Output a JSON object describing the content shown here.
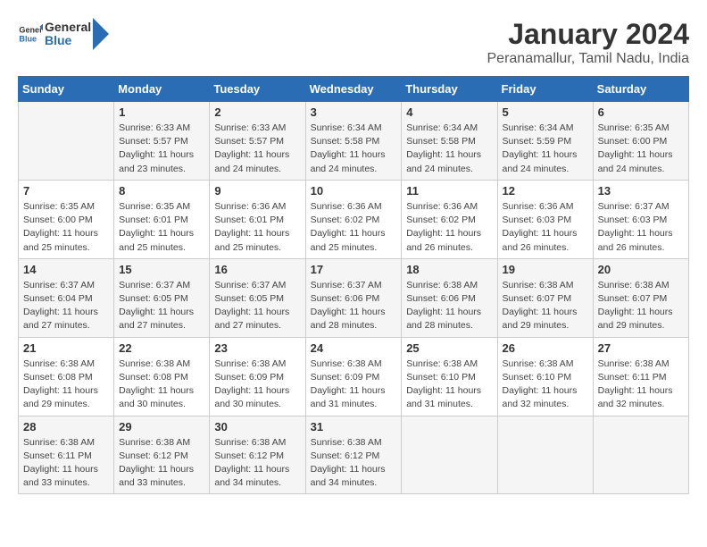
{
  "header": {
    "logo_line1": "General",
    "logo_line2": "Blue",
    "month": "January 2024",
    "location": "Peranamallur, Tamil Nadu, India"
  },
  "weekdays": [
    "Sunday",
    "Monday",
    "Tuesday",
    "Wednesday",
    "Thursday",
    "Friday",
    "Saturday"
  ],
  "weeks": [
    [
      {
        "day": "",
        "sunrise": "",
        "sunset": "",
        "daylight": ""
      },
      {
        "day": "1",
        "sunrise": "Sunrise: 6:33 AM",
        "sunset": "Sunset: 5:57 PM",
        "daylight": "Daylight: 11 hours and 23 minutes."
      },
      {
        "day": "2",
        "sunrise": "Sunrise: 6:33 AM",
        "sunset": "Sunset: 5:57 PM",
        "daylight": "Daylight: 11 hours and 24 minutes."
      },
      {
        "day": "3",
        "sunrise": "Sunrise: 6:34 AM",
        "sunset": "Sunset: 5:58 PM",
        "daylight": "Daylight: 11 hours and 24 minutes."
      },
      {
        "day": "4",
        "sunrise": "Sunrise: 6:34 AM",
        "sunset": "Sunset: 5:58 PM",
        "daylight": "Daylight: 11 hours and 24 minutes."
      },
      {
        "day": "5",
        "sunrise": "Sunrise: 6:34 AM",
        "sunset": "Sunset: 5:59 PM",
        "daylight": "Daylight: 11 hours and 24 minutes."
      },
      {
        "day": "6",
        "sunrise": "Sunrise: 6:35 AM",
        "sunset": "Sunset: 6:00 PM",
        "daylight": "Daylight: 11 hours and 24 minutes."
      }
    ],
    [
      {
        "day": "7",
        "sunrise": "Sunrise: 6:35 AM",
        "sunset": "Sunset: 6:00 PM",
        "daylight": "Daylight: 11 hours and 25 minutes."
      },
      {
        "day": "8",
        "sunrise": "Sunrise: 6:35 AM",
        "sunset": "Sunset: 6:01 PM",
        "daylight": "Daylight: 11 hours and 25 minutes."
      },
      {
        "day": "9",
        "sunrise": "Sunrise: 6:36 AM",
        "sunset": "Sunset: 6:01 PM",
        "daylight": "Daylight: 11 hours and 25 minutes."
      },
      {
        "day": "10",
        "sunrise": "Sunrise: 6:36 AM",
        "sunset": "Sunset: 6:02 PM",
        "daylight": "Daylight: 11 hours and 25 minutes."
      },
      {
        "day": "11",
        "sunrise": "Sunrise: 6:36 AM",
        "sunset": "Sunset: 6:02 PM",
        "daylight": "Daylight: 11 hours and 26 minutes."
      },
      {
        "day": "12",
        "sunrise": "Sunrise: 6:36 AM",
        "sunset": "Sunset: 6:03 PM",
        "daylight": "Daylight: 11 hours and 26 minutes."
      },
      {
        "day": "13",
        "sunrise": "Sunrise: 6:37 AM",
        "sunset": "Sunset: 6:03 PM",
        "daylight": "Daylight: 11 hours and 26 minutes."
      }
    ],
    [
      {
        "day": "14",
        "sunrise": "Sunrise: 6:37 AM",
        "sunset": "Sunset: 6:04 PM",
        "daylight": "Daylight: 11 hours and 27 minutes."
      },
      {
        "day": "15",
        "sunrise": "Sunrise: 6:37 AM",
        "sunset": "Sunset: 6:05 PM",
        "daylight": "Daylight: 11 hours and 27 minutes."
      },
      {
        "day": "16",
        "sunrise": "Sunrise: 6:37 AM",
        "sunset": "Sunset: 6:05 PM",
        "daylight": "Daylight: 11 hours and 27 minutes."
      },
      {
        "day": "17",
        "sunrise": "Sunrise: 6:37 AM",
        "sunset": "Sunset: 6:06 PM",
        "daylight": "Daylight: 11 hours and 28 minutes."
      },
      {
        "day": "18",
        "sunrise": "Sunrise: 6:38 AM",
        "sunset": "Sunset: 6:06 PM",
        "daylight": "Daylight: 11 hours and 28 minutes."
      },
      {
        "day": "19",
        "sunrise": "Sunrise: 6:38 AM",
        "sunset": "Sunset: 6:07 PM",
        "daylight": "Daylight: 11 hours and 29 minutes."
      },
      {
        "day": "20",
        "sunrise": "Sunrise: 6:38 AM",
        "sunset": "Sunset: 6:07 PM",
        "daylight": "Daylight: 11 hours and 29 minutes."
      }
    ],
    [
      {
        "day": "21",
        "sunrise": "Sunrise: 6:38 AM",
        "sunset": "Sunset: 6:08 PM",
        "daylight": "Daylight: 11 hours and 29 minutes."
      },
      {
        "day": "22",
        "sunrise": "Sunrise: 6:38 AM",
        "sunset": "Sunset: 6:08 PM",
        "daylight": "Daylight: 11 hours and 30 minutes."
      },
      {
        "day": "23",
        "sunrise": "Sunrise: 6:38 AM",
        "sunset": "Sunset: 6:09 PM",
        "daylight": "Daylight: 11 hours and 30 minutes."
      },
      {
        "day": "24",
        "sunrise": "Sunrise: 6:38 AM",
        "sunset": "Sunset: 6:09 PM",
        "daylight": "Daylight: 11 hours and 31 minutes."
      },
      {
        "day": "25",
        "sunrise": "Sunrise: 6:38 AM",
        "sunset": "Sunset: 6:10 PM",
        "daylight": "Daylight: 11 hours and 31 minutes."
      },
      {
        "day": "26",
        "sunrise": "Sunrise: 6:38 AM",
        "sunset": "Sunset: 6:10 PM",
        "daylight": "Daylight: 11 hours and 32 minutes."
      },
      {
        "day": "27",
        "sunrise": "Sunrise: 6:38 AM",
        "sunset": "Sunset: 6:11 PM",
        "daylight": "Daylight: 11 hours and 32 minutes."
      }
    ],
    [
      {
        "day": "28",
        "sunrise": "Sunrise: 6:38 AM",
        "sunset": "Sunset: 6:11 PM",
        "daylight": "Daylight: 11 hours and 33 minutes."
      },
      {
        "day": "29",
        "sunrise": "Sunrise: 6:38 AM",
        "sunset": "Sunset: 6:12 PM",
        "daylight": "Daylight: 11 hours and 33 minutes."
      },
      {
        "day": "30",
        "sunrise": "Sunrise: 6:38 AM",
        "sunset": "Sunset: 6:12 PM",
        "daylight": "Daylight: 11 hours and 34 minutes."
      },
      {
        "day": "31",
        "sunrise": "Sunrise: 6:38 AM",
        "sunset": "Sunset: 6:12 PM",
        "daylight": "Daylight: 11 hours and 34 minutes."
      },
      {
        "day": "",
        "sunrise": "",
        "sunset": "",
        "daylight": ""
      },
      {
        "day": "",
        "sunrise": "",
        "sunset": "",
        "daylight": ""
      },
      {
        "day": "",
        "sunrise": "",
        "sunset": "",
        "daylight": ""
      }
    ]
  ]
}
